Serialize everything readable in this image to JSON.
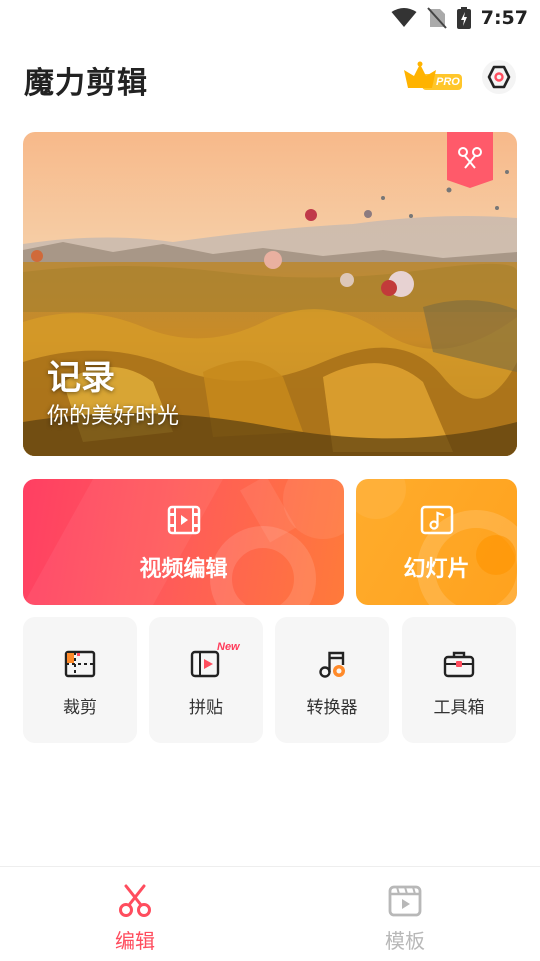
{
  "status_bar": {
    "time": "7:57"
  },
  "header": {
    "title": "魔力剪辑",
    "pro_badge": "PRO"
  },
  "hero": {
    "title": "记录",
    "subtitle": "你的美好时光"
  },
  "cards": {
    "video_edit": "视频编辑",
    "slideshow": "幻灯片"
  },
  "tools": [
    {
      "label": "裁剪",
      "icon": "crop-icon"
    },
    {
      "label": "拼贴",
      "icon": "collage-icon",
      "badge": "New"
    },
    {
      "label": "转换器",
      "icon": "music-converter-icon"
    },
    {
      "label": "工具箱",
      "icon": "toolbox-icon"
    }
  ],
  "nav": {
    "items": [
      {
        "label": "编辑",
        "active": true,
        "icon": "scissors-icon"
      },
      {
        "label": "模板",
        "active": false,
        "icon": "film-template-icon"
      }
    ]
  },
  "colors": {
    "accent": "#ff4d5e",
    "inactive": "#b8b8b8",
    "slide_card": "#ffa823"
  }
}
